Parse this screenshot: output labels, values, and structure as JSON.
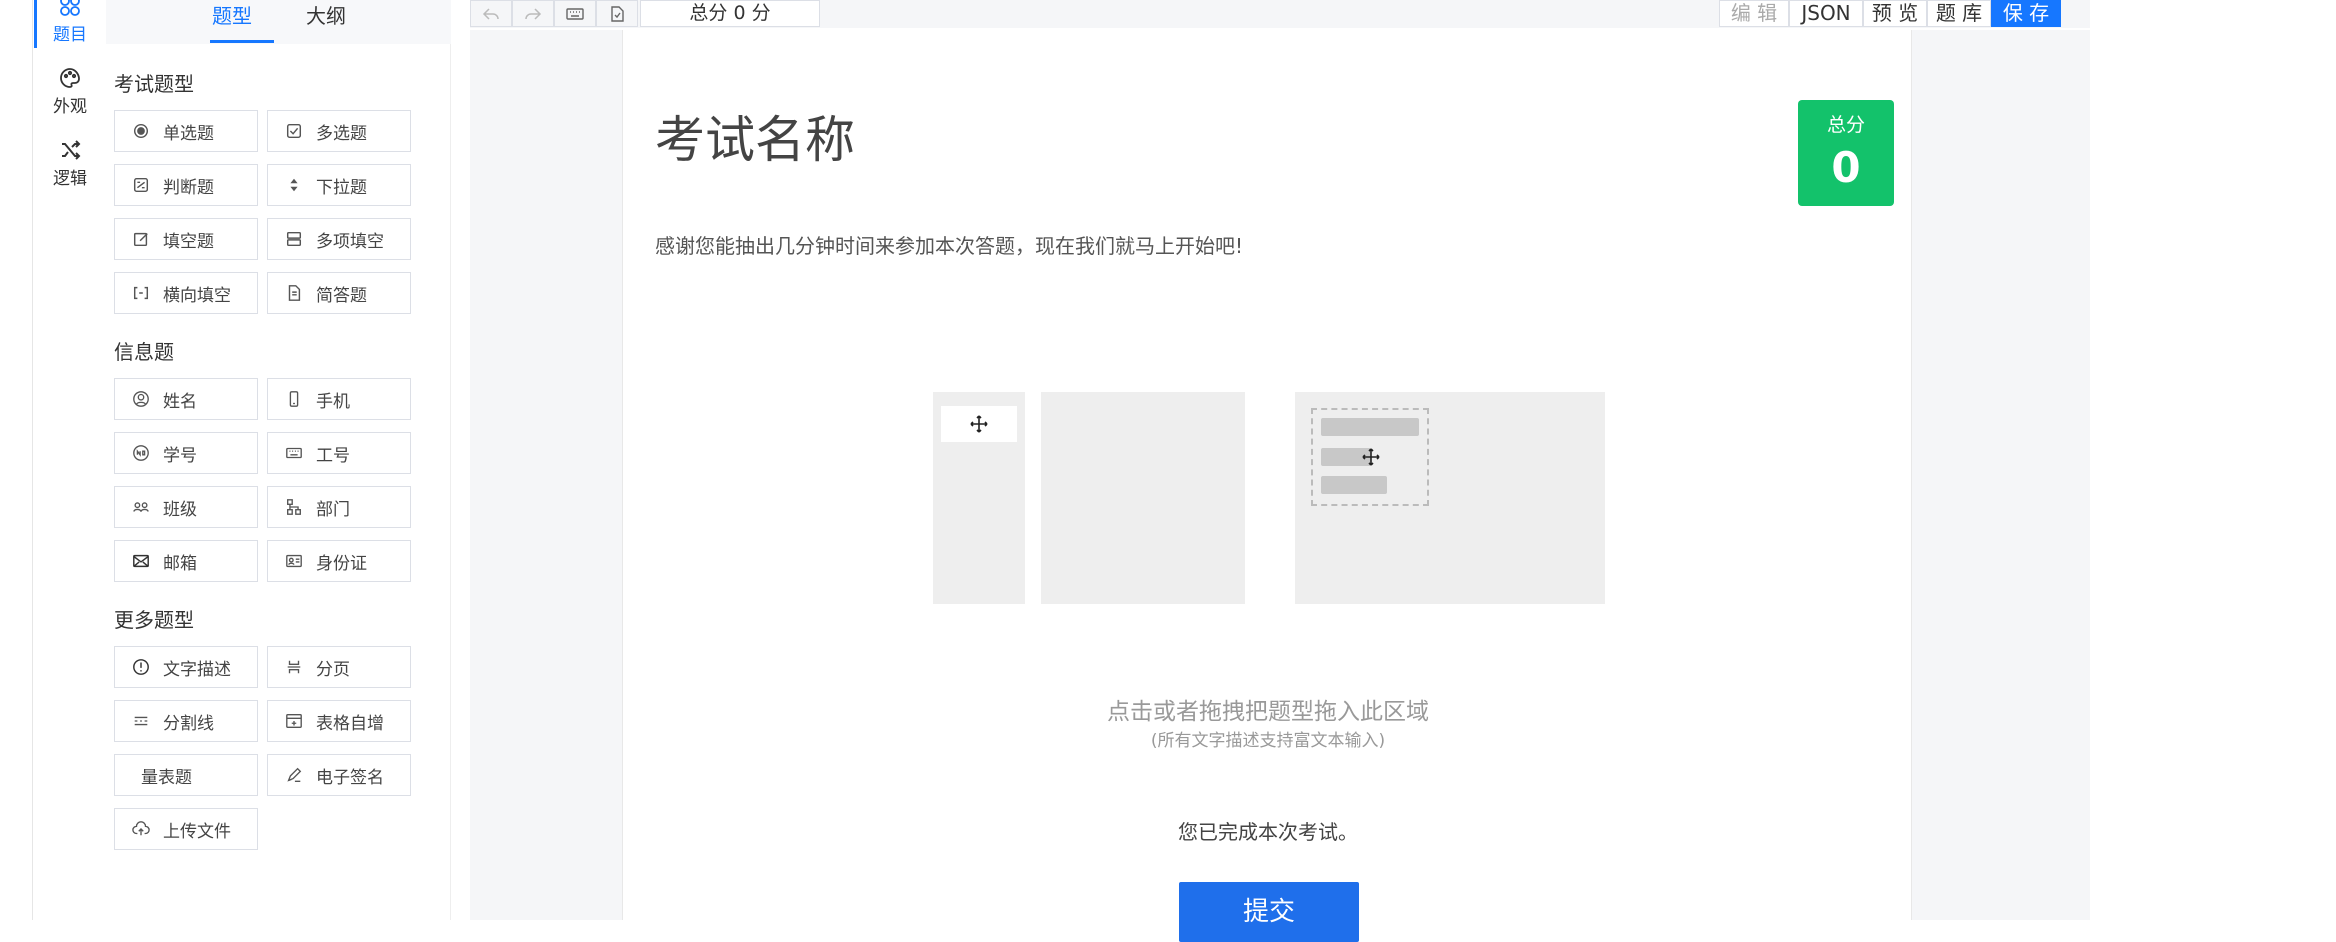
{
  "rail": {
    "items": [
      {
        "label": "题目",
        "icon": "question-icon",
        "active": true
      },
      {
        "label": "外观",
        "icon": "palette-icon",
        "active": false
      },
      {
        "label": "逻辑",
        "icon": "shuffle-icon",
        "active": false
      }
    ]
  },
  "panel": {
    "tabs": [
      "题型",
      "大纲"
    ],
    "sections": [
      {
        "title": "考试题型",
        "items": [
          {
            "label": "单选题",
            "icon": "radio-icon"
          },
          {
            "label": "多选题",
            "icon": "checkbox-icon"
          },
          {
            "label": "判断题",
            "icon": "judge-icon"
          },
          {
            "label": "下拉题",
            "icon": "sort-icon"
          },
          {
            "label": "填空题",
            "icon": "edit-icon"
          },
          {
            "label": "多项填空",
            "icon": "multi-fill-icon"
          },
          {
            "label": "横向填空",
            "icon": "bracket-icon"
          },
          {
            "label": "简答题",
            "icon": "document-icon"
          }
        ]
      },
      {
        "title": "信息题",
        "items": [
          {
            "label": "姓名",
            "icon": "user-icon"
          },
          {
            "label": "手机",
            "icon": "phone-icon"
          },
          {
            "label": "学号",
            "icon": "number-icon"
          },
          {
            "label": "工号",
            "icon": "keyboard-icon"
          },
          {
            "label": "班级",
            "icon": "group-icon"
          },
          {
            "label": "部门",
            "icon": "org-icon"
          },
          {
            "label": "邮箱",
            "icon": "mail-icon"
          },
          {
            "label": "身份证",
            "icon": "id-card-icon"
          }
        ]
      },
      {
        "title": "更多题型",
        "items": [
          {
            "label": "文字描述",
            "icon": "info-icon"
          },
          {
            "label": "分页",
            "icon": "page-break-icon"
          },
          {
            "label": "分割线",
            "icon": "divider-icon"
          },
          {
            "label": "表格自增",
            "icon": "table-add-icon"
          },
          {
            "label": "量表题",
            "icon": ""
          },
          {
            "label": "电子签名",
            "icon": "pen-icon"
          },
          {
            "label": "上传文件",
            "icon": "upload-icon"
          }
        ]
      }
    ]
  },
  "toolbar": {
    "score_text": "总分 0 分",
    "right_buttons": [
      {
        "label": "编 辑",
        "state": "disabled"
      },
      {
        "label": "JSON",
        "state": "normal"
      },
      {
        "label": "预 览",
        "state": "normal"
      },
      {
        "label": "题 库",
        "state": "normal"
      },
      {
        "label": "保 存",
        "state": "primary"
      }
    ]
  },
  "paper": {
    "title": "考试名称",
    "score_label": "总分",
    "score_value": "0",
    "intro": "感谢您能抽出几分钟时间来参加本次答题，现在我们就马上开始吧!",
    "drop_hint": "点击或者拖拽把题型拖入此区域",
    "drop_sub": "(所有文字描述支持富文本输入)",
    "done_text": "您已完成本次考试。",
    "submit_label": "提交"
  },
  "colors": {
    "primary": "#1677ff",
    "score_badge": "#13c26b",
    "submit": "#1f6feb"
  }
}
